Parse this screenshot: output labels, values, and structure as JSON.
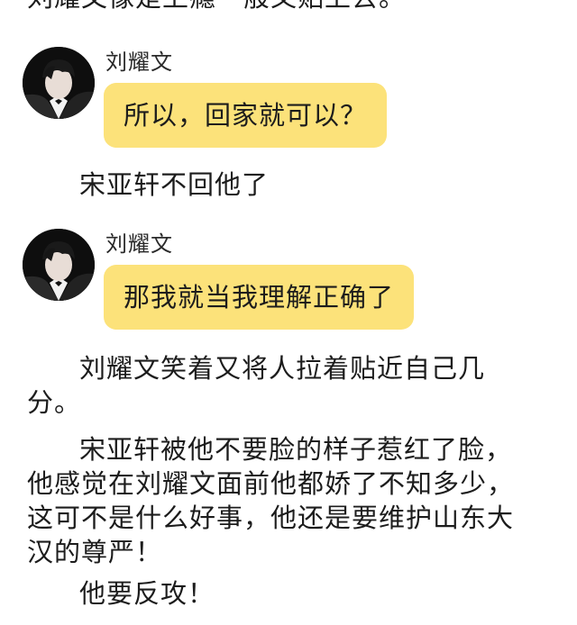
{
  "story": {
    "line_top": "刘耀文像是上瘾一般又贴上去。",
    "line_no_reply": "宋亚轩不回他了",
    "line_smile": "刘耀文笑着又将人拉着贴近自己几分。",
    "line_blush": "宋亚轩被他不要脸的样子惹红了脸，他感觉在刘耀文面前他都娇了不知多少，这可不是什么好事，他还是要维护山东大汉的尊严！",
    "line_fight": "他要反攻！"
  },
  "messages": [
    {
      "sender": "刘耀文",
      "text": "所以，回家就可以？"
    },
    {
      "sender": "刘耀文",
      "text": "那我就当我理解正确了"
    }
  ],
  "colors": {
    "bubble": "#fce27a",
    "text": "#1c1c1c",
    "avatar_bg": "#101010"
  },
  "icons": {
    "avatar": "avatar-icon"
  }
}
